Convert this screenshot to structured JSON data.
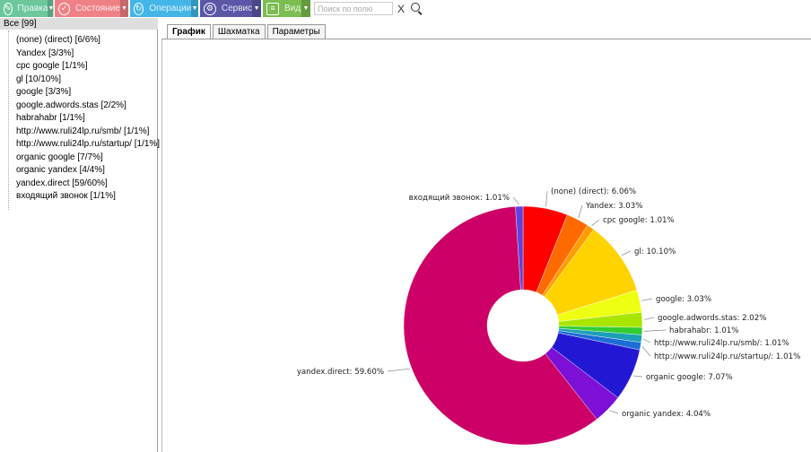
{
  "toolbar": {
    "buttons": [
      {
        "label": "Правка",
        "icon": "edit-icon",
        "color": "#6cc79d"
      },
      {
        "label": "Состояние",
        "icon": "state-icon",
        "color": "#ef8186"
      },
      {
        "label": "Операции",
        "icon": "refresh-icon",
        "color": "#43b6e7"
      },
      {
        "label": "Сервис",
        "icon": "service-icon",
        "color": "#5a57a7"
      },
      {
        "label": "Вид",
        "icon": "view-icon",
        "color": "#7bbd50"
      }
    ],
    "search_placeholder": "Поиск по полю",
    "clear_label": "X"
  },
  "tree": {
    "root": "Все [99]",
    "items": [
      "(none) (direct) [6/6%]",
      "Yandex [3/3%]",
      "cpc google [1/1%]",
      "gl [10/10%]",
      "google [3/3%]",
      "google.adwords.stas [2/2%]",
      "habrahabr [1/1%]",
      "http://www.ruli24lp.ru/smb/ [1/1%]",
      "http://www.ruli24lp.ru/startup/ [1/1%]",
      "organic google [7/7%]",
      "organic yandex [4/4%]",
      "yandex.direct [59/60%]",
      "входящий звонок [1/1%]"
    ]
  },
  "tabs": [
    "График",
    "Шахматка",
    "Параметры"
  ],
  "active_tab": "График",
  "chart_data": {
    "type": "pie",
    "donut": true,
    "slices": [
      {
        "label": "(none) (direct): 6.06%",
        "value": 6.06,
        "color": "#fe0000"
      },
      {
        "label": "Yandex: 3.03%",
        "value": 3.03,
        "color": "#ff6a00"
      },
      {
        "label": "cpc google: 1.01%",
        "value": 1.01,
        "color": "#ff9d00"
      },
      {
        "label": "gl: 10.10%",
        "value": 10.1,
        "color": "#ffd300"
      },
      {
        "label": "google: 3.03%",
        "value": 3.03,
        "color": "#eeff11"
      },
      {
        "label": "google.adwords.stas: 2.02%",
        "value": 2.02,
        "color": "#a8e600"
      },
      {
        "label": "habrahabr: 1.01%",
        "value": 1.01,
        "color": "#33cc33"
      },
      {
        "label": "http://www.ruli24lp.ru/smb/: 1.01%",
        "value": 1.01,
        "color": "#1b9fb6"
      },
      {
        "label": "http://www.ruli24lp.ru/startup/: 1.01%",
        "value": 1.01,
        "color": "#1c6dd6"
      },
      {
        "label": "organic google: 7.07%",
        "value": 7.07,
        "color": "#2218d4"
      },
      {
        "label": "organic yandex: 4.04%",
        "value": 4.04,
        "color": "#7d10d6"
      },
      {
        "label": "yandex.direct: 59.60%",
        "value": 59.6,
        "color": "#cc0066"
      },
      {
        "label": "входящий звонок: 1.01%",
        "value": 1.01,
        "color": "#5e42e0"
      }
    ]
  }
}
